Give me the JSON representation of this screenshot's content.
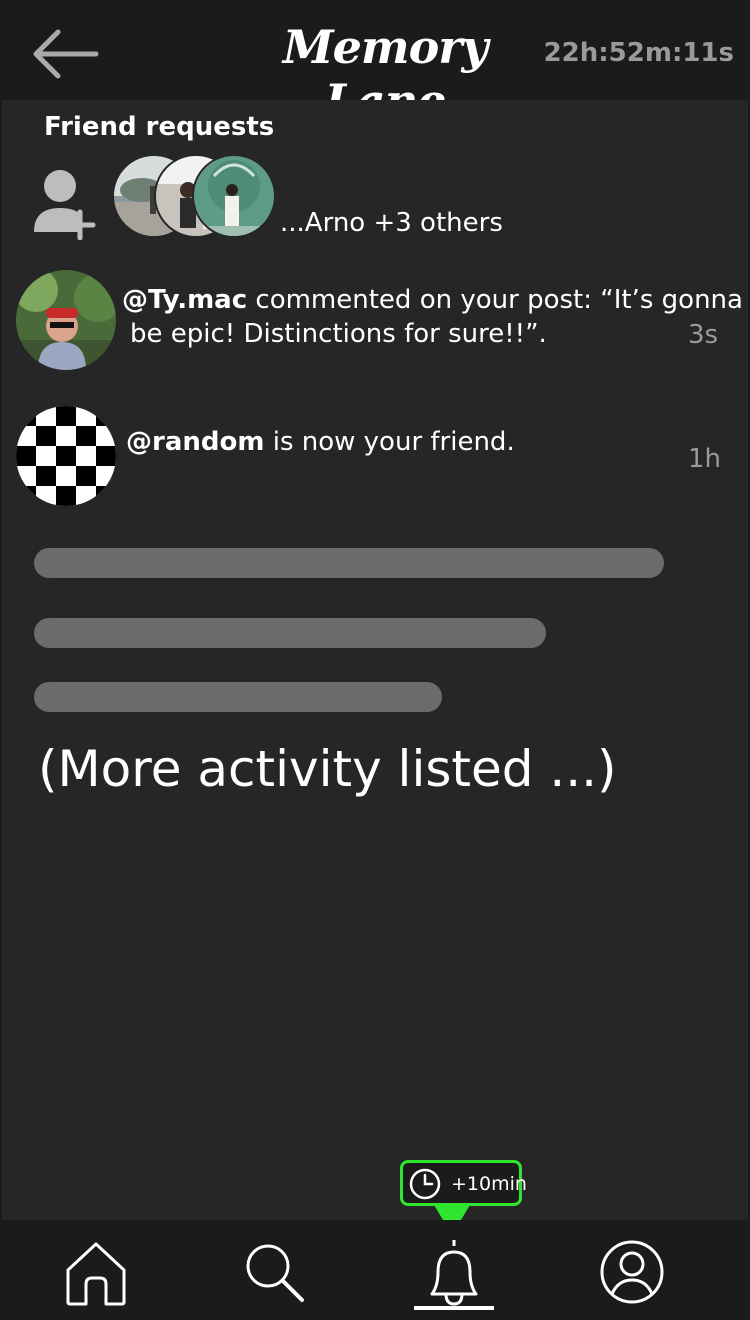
{
  "header": {
    "title": "Memory Lane",
    "timer": "22h:52m:11s"
  },
  "friend_requests": {
    "title": "Friend requests",
    "summary": "...Arno +3 others"
  },
  "activity": [
    {
      "user": "@Ty.mac",
      "line1": " commented on your post: “It’s gonna",
      "line2": "be epic! Distinctions for sure!!”.",
      "time": "3s"
    },
    {
      "user": "@random",
      "line1": " is now your friend.",
      "time": "1h"
    }
  ],
  "more_text": "(More activity listed ...)",
  "tooltip": {
    "label": "+10min"
  },
  "colors": {
    "accent_green": "#2ee62e",
    "skeleton": "#6b6b6b"
  },
  "nav": {
    "items": [
      "home-icon",
      "search-icon",
      "bell-icon",
      "profile-icon"
    ],
    "active": "bell-icon"
  }
}
